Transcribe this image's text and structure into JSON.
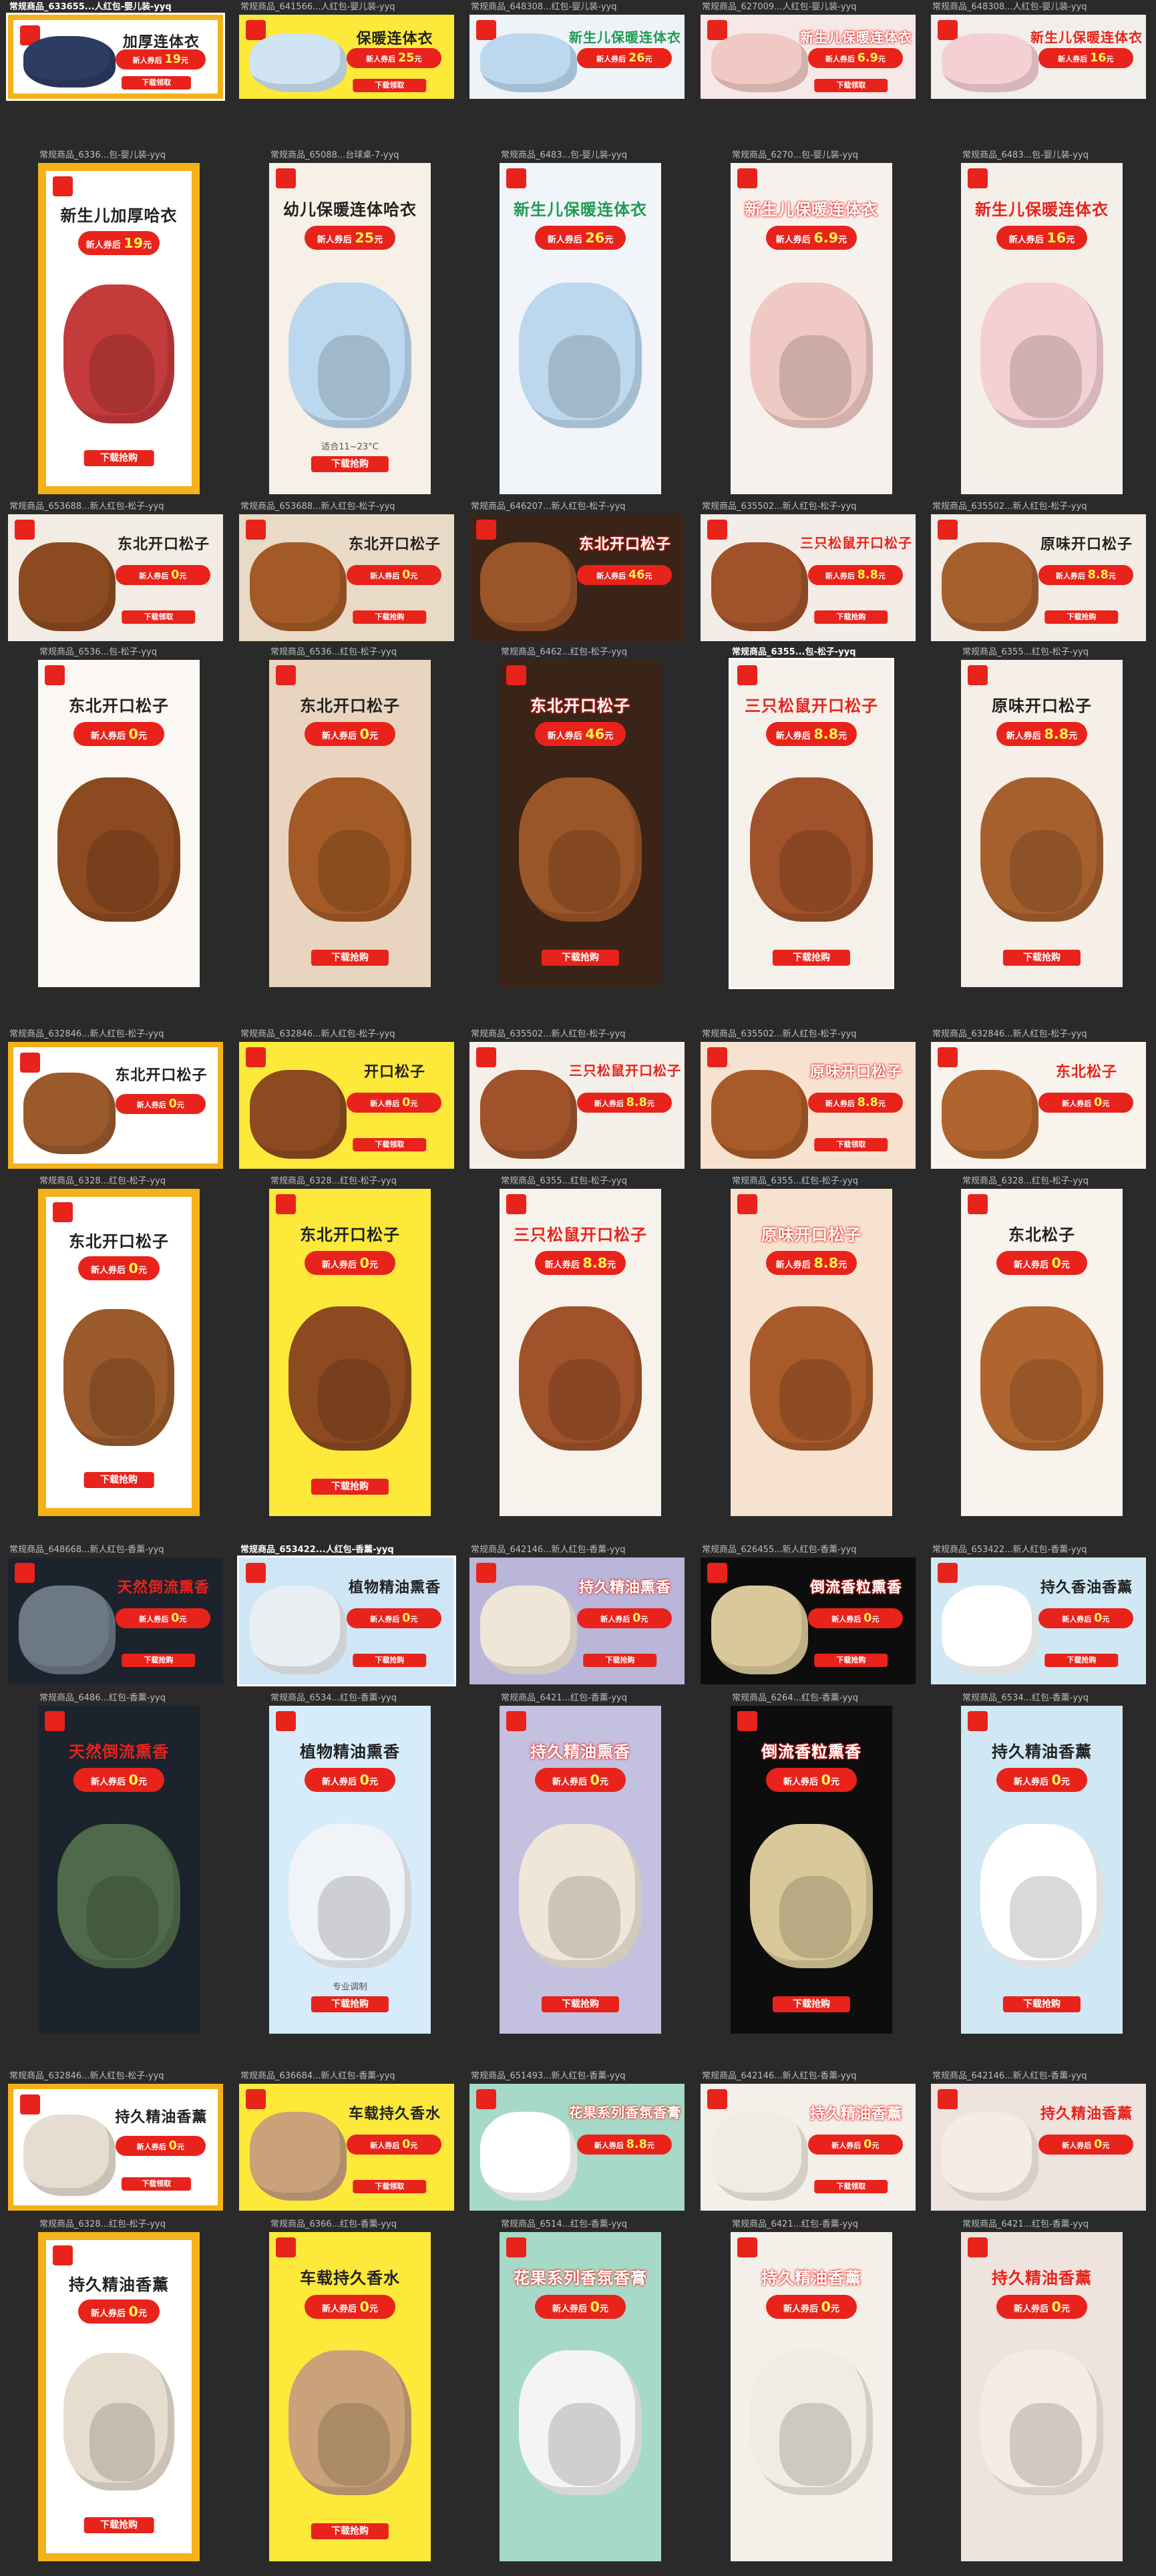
{
  "gallery": {
    "rows": [
      {
        "kind": "banner",
        "tiles": [
          {
            "label": "常规商品_633655...人红包-婴儿装-yyq",
            "title": "加厚连体衣",
            "coupon": "新人券后",
            "price": "19",
            "unit": "元",
            "cta": "下载领取",
            "bg": "#ffffff",
            "frame": "#f3b21a",
            "prod": "#2d3c63",
            "titleColor": "#222222",
            "selected": true
          },
          {
            "label": "常规商品_641566...人红包-婴儿装-yyq",
            "title": "保暖连体衣",
            "coupon": "新人券后",
            "price": "25",
            "unit": "元",
            "cta": "下载领取",
            "bg": "#fde93a",
            "frame": "",
            "prod": "#cfe3f2",
            "titleColor": "#222222",
            "selected": false
          },
          {
            "label": "常规商品_648308...红包-婴儿装-yyq",
            "title": "新生儿保暖连体衣",
            "coupon": "新人券后",
            "price": "26",
            "unit": "元",
            "cta": "",
            "bg": "#eef3f8",
            "frame": "",
            "prod": "#bcd8ee",
            "titleColor": "#1e9b52",
            "selected": false
          },
          {
            "label": "常规商品_627009...人红包-婴儿装-yyq",
            "title": "新生儿保暖连体衣",
            "coupon": "新人券后",
            "price": "6.9",
            "unit": "元",
            "cta": "下载领取",
            "bg": "#f6e8e6",
            "frame": "",
            "prod": "#f0c9c4",
            "titleColor": "#ffffff",
            "selected": false
          },
          {
            "label": "常规商品_648308...人红包-婴儿装-yyq",
            "title": "新生儿保暖连体衣",
            "coupon": "新人券后",
            "price": "16",
            "unit": "元",
            "cta": "",
            "bg": "#f2eee9",
            "frame": "",
            "prod": "#f4d0d4",
            "titleColor": "#e8231b",
            "selected": false
          }
        ]
      },
      {
        "kind": "poster",
        "tiles": [
          {
            "label": "常规商品_6336...包-婴儿装-yyq",
            "title": "新生儿加厚哈衣",
            "coupon": "新人券后",
            "price": "19",
            "unit": "元",
            "cta": "下载抢购",
            "caption": "",
            "bg": "#ffffff",
            "frame": "#f3b21a",
            "prod": "#c43b3b",
            "titleColor": "#222222",
            "selected": false
          },
          {
            "label": "常规商品_65088...台球桌-7-yyq",
            "title": "幼儿保暖连体哈衣",
            "coupon": "新人券后",
            "price": "25",
            "unit": "元",
            "cta": "下载抢购",
            "caption": "适合11~23°C",
            "bg": "#f6f0e6",
            "frame": "",
            "prod": "#bcd8ee",
            "titleColor": "#222222",
            "selected": false
          },
          {
            "label": "常规商品_6483...包-婴儿装-yyq",
            "title": "新生儿保暖连体衣",
            "coupon": "新人券后",
            "price": "26",
            "unit": "元",
            "cta": "",
            "caption": "",
            "bg": "#f1f4f8",
            "frame": "",
            "prod": "#bcd8ee",
            "titleColor": "#1e9b52",
            "selected": false
          },
          {
            "label": "常规商品_6270...包-婴儿装-yyq",
            "title": "新生儿保暖连体衣",
            "coupon": "新人券后",
            "price": "6.9",
            "unit": "元",
            "cta": "",
            "caption": "",
            "bg": "#f7f1ee",
            "frame": "",
            "prod": "#f0c9c4",
            "titleColor": "#ffffff",
            "selected": false
          },
          {
            "label": "常规商品_6483...包-婴儿装-yyq",
            "title": "新生儿保暖连体衣",
            "coupon": "新人券后",
            "price": "16",
            "unit": "元",
            "cta": "",
            "caption": "",
            "bg": "#f4efe9",
            "frame": "",
            "prod": "#f4d0d4",
            "titleColor": "#e8231b",
            "selected": false
          }
        ]
      },
      {
        "kind": "banner",
        "tiles": [
          {
            "label": "常规商品_653688...新人红包-松子-yyq",
            "title": "东北开口松子",
            "coupon": "新人券后",
            "price": "0",
            "unit": "元",
            "cta": "下载领取",
            "bg": "#f3ece4",
            "frame": "",
            "prod": "#8c4a20",
            "titleColor": "#222222",
            "selected": false
          },
          {
            "label": "常规商品_653688...新人红包-松子-yyq",
            "title": "东北开口松子",
            "coupon": "新人券后",
            "price": "0",
            "unit": "元",
            "cta": "下载抢购",
            "bg": "#e9d9c7",
            "frame": "",
            "prod": "#a45a26",
            "titleColor": "#222222",
            "selected": false
          },
          {
            "label": "常规商品_646207...新人红包-松子-yyq",
            "title": "东北开口松子",
            "coupon": "新人券后",
            "price": "46",
            "unit": "元",
            "cta": "",
            "bg": "#3a2418",
            "frame": "",
            "prod": "#9a5528",
            "titleColor": "#ffffff",
            "selected": false
          },
          {
            "label": "常规商品_635502...新人红包-松子-yyq",
            "title": "三只松鼠开口松子",
            "coupon": "新人券后",
            "price": "8.8",
            "unit": "元",
            "cta": "下载抢购",
            "bg": "#f4ece6",
            "frame": "",
            "prod": "#a0522a",
            "titleColor": "#e8231b",
            "selected": false
          },
          {
            "label": "常规商品_635502...新人红包-松子-yyq",
            "title": "原味开口松子",
            "coupon": "新人券后",
            "price": "8.8",
            "unit": "元",
            "cta": "下载抢购",
            "bg": "#f3ede6",
            "frame": "",
            "prod": "#a6602e",
            "titleColor": "#222222",
            "selected": false
          }
        ]
      },
      {
        "kind": "poster",
        "tiles": [
          {
            "label": "常规商品_6536...包-松子-yyq",
            "title": "东北开口松子",
            "coupon": "新人券后",
            "price": "0",
            "unit": "元",
            "cta": "",
            "caption": "",
            "bg": "#fbf7f2",
            "frame": "",
            "prod": "#8c4a20",
            "titleColor": "#222222",
            "selected": false
          },
          {
            "label": "常规商品_6536...红包-松子-yyq",
            "title": "东北开口松子",
            "coupon": "新人券后",
            "price": "0",
            "unit": "元",
            "cta": "下载抢购",
            "caption": "",
            "bg": "#e9d5bf",
            "frame": "",
            "prod": "#a45a26",
            "titleColor": "#222222",
            "selected": false
          },
          {
            "label": "常规商品_6462...红包-松子-yyq",
            "title": "东北开口松子",
            "coupon": "新人券后",
            "price": "46",
            "unit": "元",
            "cta": "下载抢购",
            "caption": "",
            "bg": "#3a2418",
            "frame": "",
            "prod": "#9a5528",
            "titleColor": "#ffffff",
            "selected": false
          },
          {
            "label": "常规商品_6355...包-松子-yyq",
            "title": "三只松鼠开口松子",
            "coupon": "新人券后",
            "price": "8.8",
            "unit": "元",
            "cta": "下载抢购",
            "caption": "",
            "bg": "#f6f0ea",
            "frame": "",
            "prod": "#a0522a",
            "titleColor": "#e8231b",
            "selected": true
          },
          {
            "label": "常规商品_6355...红包-松子-yyq",
            "title": "原味开口松子",
            "coupon": "新人券后",
            "price": "8.8",
            "unit": "元",
            "cta": "下载抢购",
            "caption": "",
            "bg": "#f6efe7",
            "frame": "",
            "prod": "#a6602e",
            "titleColor": "#222222",
            "selected": false
          }
        ]
      },
      {
        "kind": "banner",
        "tiles": [
          {
            "label": "常规商品_632846...新人红包-松子-yyq",
            "title": "东北开口松子",
            "coupon": "新人券后",
            "price": "0",
            "unit": "元",
            "cta": "",
            "bg": "#ffffff",
            "frame": "#f3b21a",
            "prod": "#9a5a2c",
            "titleColor": "#222222",
            "selected": false
          },
          {
            "label": "常规商品_632846...新人红包-松子-yyq",
            "title": "开口松子",
            "coupon": "新人券后",
            "price": "0",
            "unit": "元",
            "cta": "下载领取",
            "bg": "#fde93a",
            "frame": "",
            "prod": "#8c4a20",
            "titleColor": "#222222",
            "selected": false
          },
          {
            "label": "常规商品_635502...新人红包-松子-yyq",
            "title": "三只松鼠开口松子",
            "coupon": "新人券后",
            "price": "8.8",
            "unit": "元",
            "cta": "",
            "bg": "#f5efe9",
            "frame": "",
            "prod": "#a0522a",
            "titleColor": "#e8231b",
            "selected": false
          },
          {
            "label": "常规商品_635502...新人红包-松子-yyq",
            "title": "原味开口松子",
            "coupon": "新人券后",
            "price": "8.8",
            "unit": "元",
            "cta": "下载领取",
            "bg": "#f6e2cf",
            "frame": "",
            "prod": "#a85a2a",
            "titleColor": "#ffffff",
            "selected": false
          },
          {
            "label": "常规商品_632846...新人红包-松子-yyq",
            "title": "东北松子",
            "coupon": "新人券后",
            "price": "0",
            "unit": "元",
            "cta": "",
            "bg": "#f8f3ec",
            "frame": "",
            "prod": "#b0652e",
            "titleColor": "#e8231b",
            "selected": false
          }
        ]
      },
      {
        "kind": "poster",
        "tiles": [
          {
            "label": "常规商品_6328...红包-松子-yyq",
            "title": "东北开口松子",
            "coupon": "新人券后",
            "price": "0",
            "unit": "元",
            "cta": "下载抢购",
            "caption": "",
            "bg": "#ffffff",
            "frame": "#f3b21a",
            "prod": "#9a5a2c",
            "titleColor": "#222222",
            "selected": false
          },
          {
            "label": "常规商品_6328...红包-松子-yyq",
            "title": "东北开口松子",
            "coupon": "新人券后",
            "price": "0",
            "unit": "元",
            "cta": "下载抢购",
            "caption": "",
            "bg": "#fde93a",
            "frame": "",
            "prod": "#8c4a20",
            "titleColor": "#222222",
            "selected": false
          },
          {
            "label": "常规商品_6355...红包-松子-yyq",
            "title": "三只松鼠开口松子",
            "coupon": "新人券后",
            "price": "8.8",
            "unit": "元",
            "cta": "",
            "caption": "",
            "bg": "#f7f2ec",
            "frame": "",
            "prod": "#a0522a",
            "titleColor": "#e8231b",
            "selected": false
          },
          {
            "label": "常规商品_6355...红包-松子-yyq",
            "title": "原味开口松子",
            "coupon": "新人券后",
            "price": "8.8",
            "unit": "元",
            "cta": "",
            "caption": "",
            "bg": "#f6e2cf",
            "frame": "",
            "prod": "#a85a2a",
            "titleColor": "#ffffff",
            "selected": false
          },
          {
            "label": "常规商品_6328...红包-松子-yyq",
            "title": "东北松子",
            "coupon": "新人券后",
            "price": "0",
            "unit": "元",
            "cta": "",
            "caption": "",
            "bg": "#f8f3ec",
            "frame": "",
            "prod": "#b0652e",
            "titleColor": "#222222",
            "selected": false
          }
        ]
      },
      {
        "kind": "banner",
        "tiles": [
          {
            "label": "常规商品_648668...新人红包-香薰-yyq",
            "title": "天然倒流熏香",
            "coupon": "新人券后",
            "price": "0",
            "unit": "元",
            "cta": "下载抢购",
            "bg": "#1c232c",
            "frame": "",
            "prod": "#6c7886",
            "titleColor": "#e8231b",
            "selected": false
          },
          {
            "label": "常规商品_653422...人红包-香薰-yyq",
            "title": "植物精油熏香",
            "coupon": "新人券后",
            "price": "0",
            "unit": "元",
            "cta": "下载抢购",
            "bg": "#cfe6f6",
            "frame": "",
            "prod": "#e9eef2",
            "titleColor": "#222222",
            "selected": true
          },
          {
            "label": "常规商品_642146...新人红包-香薰-yyq",
            "title": "持久精油熏香",
            "coupon": "新人券后",
            "price": "0",
            "unit": "元",
            "cta": "下载抢购",
            "bg": "#b9b6d9",
            "frame": "",
            "prod": "#efe6d8",
            "titleColor": "#ffffff",
            "selected": false
          },
          {
            "label": "常规商品_626455...新人红包-香薰-yyq",
            "title": "倒流香粒熏香",
            "coupon": "新人券后",
            "price": "0",
            "unit": "元",
            "cta": "下载抢购",
            "bg": "#0d0d0d",
            "frame": "",
            "prod": "#d9c99a",
            "titleColor": "#ffffff",
            "selected": false
          },
          {
            "label": "常规商品_653422...新人红包-香薰-yyq",
            "title": "持久香油香薰",
            "coupon": "新人券后",
            "price": "0",
            "unit": "元",
            "cta": "下载抢购",
            "bg": "#cfe8f4",
            "frame": "",
            "prod": "#ffffff",
            "titleColor": "#222222",
            "selected": false
          }
        ]
      },
      {
        "kind": "poster",
        "tiles": [
          {
            "label": "常规商品_6486...红包-香薰-yyq",
            "title": "天然倒流熏香",
            "coupon": "新人券后",
            "price": "0",
            "unit": "元",
            "cta": "",
            "caption": "",
            "bg": "#1c232c",
            "frame": "",
            "prod": "#4f6a4a",
            "titleColor": "#e8231b",
            "selected": false
          },
          {
            "label": "常规商品_6534...红包-香薰-yyq",
            "title": "植物精油熏香",
            "coupon": "新人券后",
            "price": "0",
            "unit": "元",
            "cta": "下载抢购",
            "caption": "专业调制",
            "bg": "#d6ecfa",
            "frame": "",
            "prod": "#f1f4f7",
            "titleColor": "#222222",
            "selected": false
          },
          {
            "label": "常规商品_6421...红包-香薰-yyq",
            "title": "持久精油熏香",
            "coupon": "新人券后",
            "price": "0",
            "unit": "元",
            "cta": "下载抢购",
            "caption": "",
            "bg": "#c4c0e0",
            "frame": "",
            "prod": "#efe6d8",
            "titleColor": "#ffffff",
            "selected": false
          },
          {
            "label": "常规商品_6264...红包-香薰-yyq",
            "title": "倒流香粒熏香",
            "coupon": "新人券后",
            "price": "0",
            "unit": "元",
            "cta": "下载抢购",
            "caption": "",
            "bg": "#0d0d0d",
            "frame": "",
            "prod": "#d9c99a",
            "titleColor": "#ffffff",
            "selected": false
          },
          {
            "label": "常规商品_6534...红包-香薰-yyq",
            "title": "持久精油香薰",
            "coupon": "新人券后",
            "price": "0",
            "unit": "元",
            "cta": "下载抢购",
            "caption": "",
            "bg": "#cfe8f4",
            "frame": "",
            "prod": "#ffffff",
            "titleColor": "#222222",
            "selected": false
          }
        ]
      },
      {
        "kind": "banner",
        "tiles": [
          {
            "label": "常规商品_632846...新人红包-松子-yyq",
            "title": "持久精油香薰",
            "coupon": "新人券后",
            "price": "0",
            "unit": "元",
            "cta": "下载领取",
            "bg": "#ffffff",
            "frame": "#f3b21a",
            "prod": "#e6ddd0",
            "titleColor": "#222222",
            "selected": false
          },
          {
            "label": "常规商品_636684...新人红包-香薰-yyq",
            "title": "车载持久香水",
            "coupon": "新人券后",
            "price": "0",
            "unit": "元",
            "cta": "下载领取",
            "bg": "#fde93a",
            "frame": "",
            "prod": "#c9a27a",
            "titleColor": "#222222",
            "selected": false
          },
          {
            "label": "常规商品_651493...新人红包-香薰-yyq",
            "title": "花果系列香氛香膏",
            "coupon": "新人券后",
            "price": "8.8",
            "unit": "元",
            "cta": "",
            "bg": "#a7d9c8",
            "frame": "",
            "prod": "#ffffff",
            "titleColor": "#ffffff",
            "selected": false
          },
          {
            "label": "常规商品_642146...新人红包-香薰-yyq",
            "title": "持久精油香薰",
            "coupon": "新人券后",
            "price": "0",
            "unit": "元",
            "cta": "下载领取",
            "bg": "#f4efe9",
            "frame": "",
            "prod": "#f1ece3",
            "titleColor": "#ffffff",
            "selected": false
          },
          {
            "label": "常规商品_642146...新人红包-香薰-yyq",
            "title": "持久精油香薰",
            "coupon": "新人券后",
            "price": "0",
            "unit": "元",
            "cta": "",
            "bg": "#eee3dd",
            "frame": "",
            "prod": "#f4ede4",
            "titleColor": "#e8231b",
            "selected": false
          }
        ]
      },
      {
        "kind": "poster",
        "tiles": [
          {
            "label": "常规商品_6328...红包-松子-yyq",
            "title": "持久精油香薰",
            "coupon": "新人券后",
            "price": "0",
            "unit": "元",
            "cta": "下载抢购",
            "caption": "",
            "bg": "#ffffff",
            "frame": "#f3b21a",
            "prod": "#e6ddd0",
            "titleColor": "#222222",
            "selected": false
          },
          {
            "label": "常规商品_6366...红包-香薰-yyq",
            "title": "车载持久香水",
            "coupon": "新人券后",
            "price": "0",
            "unit": "元",
            "cta": "下载抢购",
            "caption": "",
            "bg": "#fde93a",
            "frame": "",
            "prod": "#c9a27a",
            "titleColor": "#222222",
            "selected": false
          },
          {
            "label": "常规商品_6514...红包-香薰-yyq",
            "title": "花果系列香氛香膏",
            "coupon": "新人券后",
            "price": "0",
            "unit": "元",
            "cta": "",
            "caption": "",
            "bg": "#a7d9c8",
            "frame": "",
            "prod": "#f4f4f4",
            "titleColor": "#ffffff",
            "selected": false
          },
          {
            "label": "常规商品_6421...红包-香薰-yyq",
            "title": "持久精油香薰",
            "coupon": "新人券后",
            "price": "0",
            "unit": "元",
            "cta": "",
            "caption": "",
            "bg": "#f4efe9",
            "frame": "",
            "prod": "#f1ece3",
            "titleColor": "#ffffff",
            "selected": false
          },
          {
            "label": "常规商品_6421...红包-香薰-yyq",
            "title": "持久精油香薰",
            "coupon": "新人券后",
            "price": "0",
            "unit": "元",
            "cta": "",
            "caption": "",
            "bg": "#eee3dd",
            "frame": "",
            "prod": "#f4ede4",
            "titleColor": "#e8231b",
            "selected": false
          }
        ]
      }
    ],
    "tag_text": "新人红包"
  }
}
